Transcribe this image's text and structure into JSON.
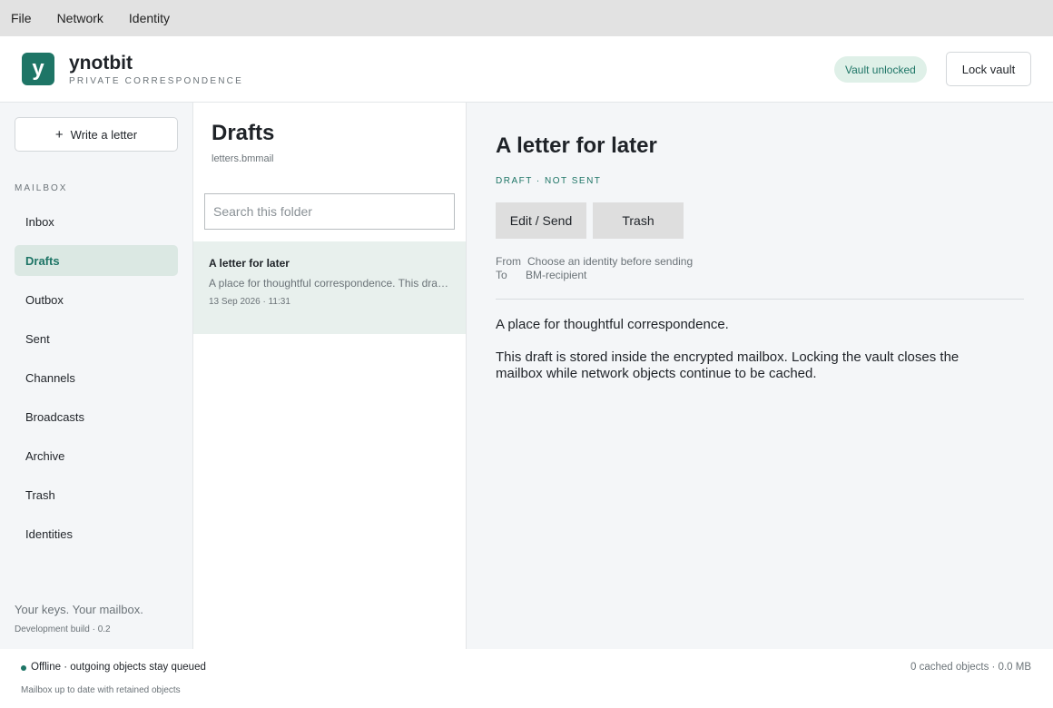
{
  "menu": [
    "File",
    "Network",
    "Identity"
  ],
  "header": {
    "logo_letter": "y",
    "title": "ynotbit",
    "subtitle": "PRIVATE CORRESPONDENCE",
    "vault_status": "Vault unlocked",
    "lock_label": "Lock vault"
  },
  "sidebar": {
    "write_label": "Write a letter",
    "mailbox_heading": "MAILBOX",
    "items": [
      {
        "label": "Inbox",
        "active": false
      },
      {
        "label": "Drafts",
        "active": true
      },
      {
        "label": "Outbox",
        "active": false
      },
      {
        "label": "Sent",
        "active": false
      },
      {
        "label": "Channels",
        "active": false
      },
      {
        "label": "Broadcasts",
        "active": false
      },
      {
        "label": "Archive",
        "active": false
      },
      {
        "label": "Trash",
        "active": false
      },
      {
        "label": "Identities",
        "active": false
      }
    ],
    "footer_tagline": "Your keys. Your mailbox.",
    "footer_build": "Development build · 0.2"
  },
  "list": {
    "folder_title": "Drafts",
    "folder_address": "letters.bmmail",
    "search_placeholder": "Search this folder",
    "messages": [
      {
        "subject": "A letter for later",
        "preview": "A place for thoughtful correspondence.  This draft is stored inside the encrypted mailbox.",
        "date": "13 Sep 2026 · 11:31"
      }
    ]
  },
  "reader": {
    "title": "A letter for later",
    "status": "DRAFT · NOT SENT",
    "edit_label": "Edit / Send",
    "trash_label": "Trash",
    "from_label": "From",
    "from_value": "Choose an identity before sending",
    "to_label": "To",
    "to_value": "BM-recipient",
    "body_p1": "A place for thoughtful correspondence.",
    "body_p2": "This draft is stored inside the encrypted mailbox. Locking the vault closes the mailbox while network objects continue to be cached."
  },
  "status": {
    "connection": "Offline · outgoing objects stay queued",
    "cache": "0 cached objects · 0.0 MB",
    "sync": "Mailbox up to date with retained objects"
  },
  "colors": {
    "accent": "#1e7566",
    "active_bg": "#dbe8e3",
    "badge_bg": "#dff0e8"
  }
}
